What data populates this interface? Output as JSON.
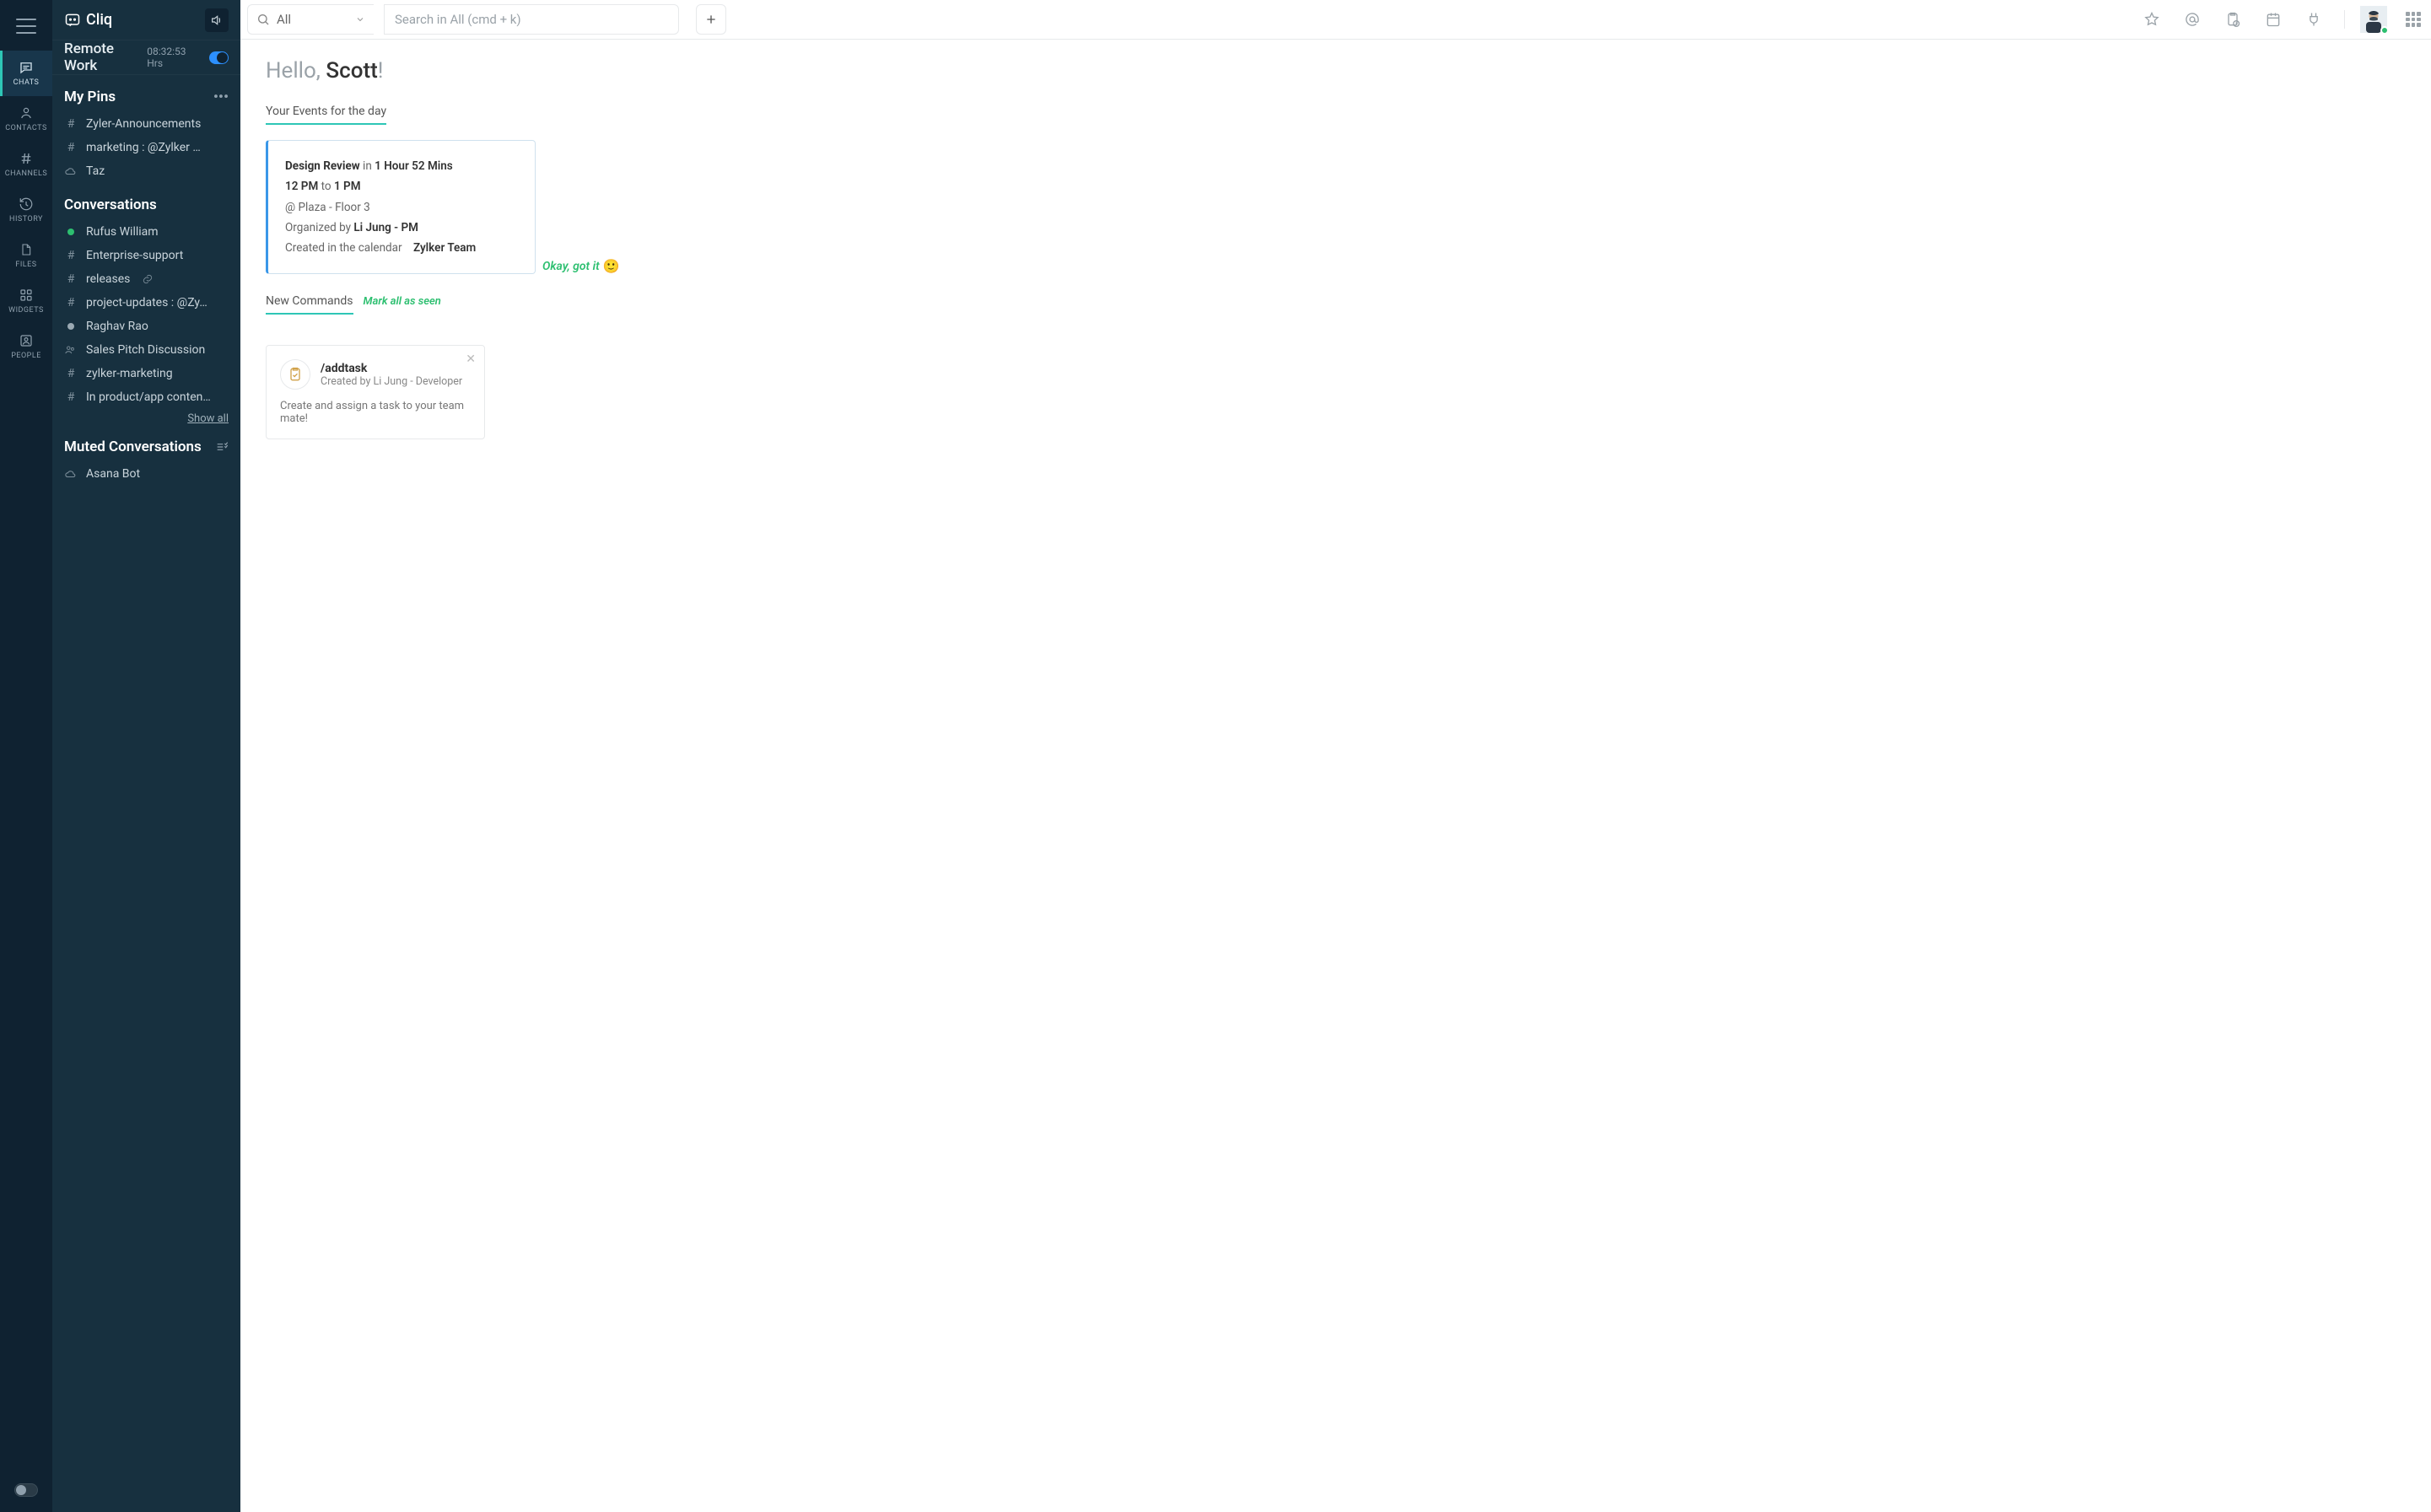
{
  "app": {
    "name": "Cliq"
  },
  "sidebar_nav": [
    {
      "key": "chats",
      "label": "CHATS",
      "active": true
    },
    {
      "key": "contacts",
      "label": "CONTACTS",
      "active": false
    },
    {
      "key": "channels",
      "label": "CHANNELS",
      "active": false
    },
    {
      "key": "history",
      "label": "HISTORY",
      "active": false
    },
    {
      "key": "files",
      "label": "FILES",
      "active": false
    },
    {
      "key": "widgets",
      "label": "WIDGETS",
      "active": false
    },
    {
      "key": "people",
      "label": "PEOPLE",
      "active": false
    }
  ],
  "remote_work": {
    "title": "Remote Work",
    "hours": "08:32:53 Hrs",
    "enabled": true
  },
  "pins": {
    "header": "My Pins",
    "items": [
      {
        "type": "hash",
        "label": "Zyler-Announcements"
      },
      {
        "type": "hash",
        "label": "marketing : @Zylker …"
      },
      {
        "type": "cloud",
        "label": "Taz"
      }
    ]
  },
  "conversations": {
    "header": "Conversations",
    "items": [
      {
        "type": "presence",
        "presence": "green",
        "label": "Rufus William"
      },
      {
        "type": "hash",
        "label": "Enterprise-support"
      },
      {
        "type": "hash",
        "label": "releases",
        "linked": true
      },
      {
        "type": "hash",
        "label": "project-updates : @Zy…"
      },
      {
        "type": "presence",
        "presence": "idle",
        "label": "Raghav Rao"
      },
      {
        "type": "chat",
        "label": "Sales Pitch Discussion"
      },
      {
        "type": "hash",
        "label": "zylker-marketing"
      },
      {
        "type": "hash",
        "label": "In product/app conten…"
      }
    ],
    "show_all": "Show all"
  },
  "muted": {
    "header": "Muted Conversations",
    "items": [
      {
        "type": "cloud",
        "label": "Asana Bot"
      }
    ]
  },
  "topbar": {
    "scope_label": "All",
    "search_placeholder": "Search in All (cmd + k)"
  },
  "home": {
    "hello_prefix": "Hello, ",
    "hello_name": "Scott",
    "hello_suffix": "!",
    "events_header": "Your Events for the day",
    "event": {
      "title": "Design Review",
      "in_word": "in",
      "countdown": "1 Hour 52 Mins",
      "start": "12 PM",
      "to_word": "to",
      "end": "1 PM",
      "location": "@ Plaza - Floor 3",
      "org_prefix": "Organized by",
      "organizer": "Li Jung - PM",
      "cal_prefix": "Created in the calendar",
      "calendar": "Zylker Team"
    },
    "okay_label": "Okay, got it",
    "okay_emoji": "🙂",
    "commands_header": "New Commands",
    "mark_seen": "Mark all as seen",
    "command": {
      "name": "/addtask",
      "creator": "Created by Li Jung - Developer",
      "desc": "Create and assign a task to your team mate!"
    }
  }
}
